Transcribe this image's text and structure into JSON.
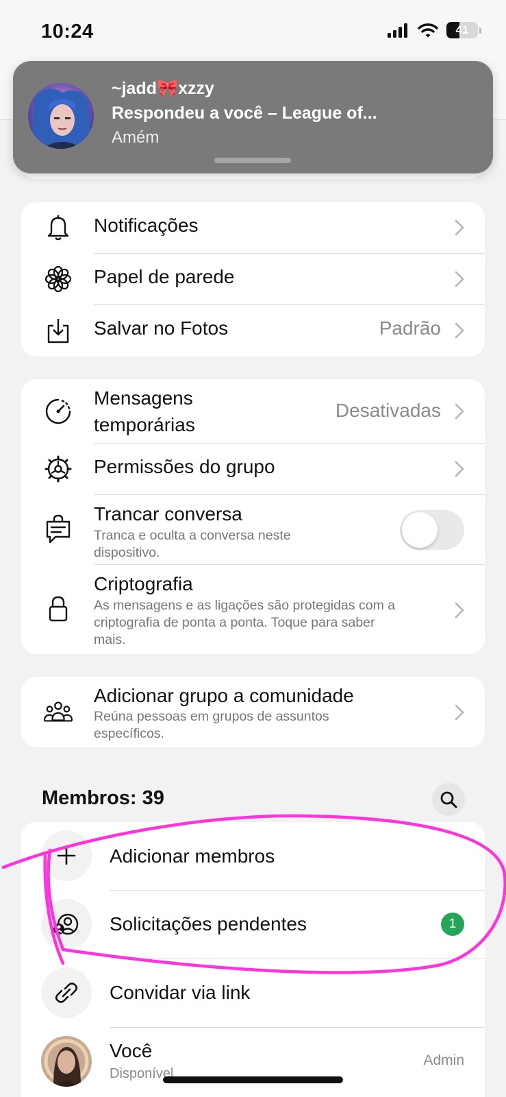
{
  "status_bar": {
    "time": "10:24",
    "battery": "41",
    "battery_level": 0.41
  },
  "notification": {
    "sender_prefix": "~jadd",
    "sender_emoji": "🎀",
    "sender_suffix": "xzzy",
    "subject": "Respondeu a você – League of...",
    "preview": "Amém"
  },
  "settings_group_1": [
    {
      "label": "Notificações",
      "value": "",
      "icon": "bell-icon"
    },
    {
      "label": "Papel de parede",
      "value": "",
      "icon": "flower-icon"
    },
    {
      "label": "Salvar no Fotos",
      "value": "Padrão",
      "icon": "download-icon"
    }
  ],
  "settings_group_2": {
    "disappearing": {
      "label_line1": "Mensagens",
      "label_line2": "temporárias",
      "value": "Desativadas",
      "icon": "timer-icon"
    },
    "permissions": {
      "label": "Permissões do grupo",
      "icon": "gear-icon"
    },
    "lock": {
      "label": "Trancar conversa",
      "sub_line1": "Tranca e oculta a conversa neste",
      "sub_line2": "dispositivo.",
      "toggle_on": false,
      "icon": "chat-lock-icon"
    },
    "encryption": {
      "label": "Criptografia",
      "sub_line1": "As mensagens e as ligações são protegidas com a",
      "sub_line2": "criptografia de ponta a ponta. Toque para saber",
      "sub_line3": "mais.",
      "icon": "lock-icon"
    }
  },
  "community": {
    "label": "Adicionar grupo a comunidade",
    "sub_line1": "Reúna pessoas em grupos de assuntos",
    "sub_line2": "específicos.",
    "icon": "people-icon"
  },
  "members": {
    "title": "Membros: 39",
    "add": "Adicionar membros",
    "pending": "Solicitações pendentes",
    "pending_count": "1",
    "invite": "Convidar via link",
    "me_name": "Você",
    "me_status": "Disponível",
    "me_role": "Admin"
  },
  "colors": {
    "badge": "#25a55a",
    "annotation": "#ff33dd",
    "banner": "#7a7a7a"
  }
}
